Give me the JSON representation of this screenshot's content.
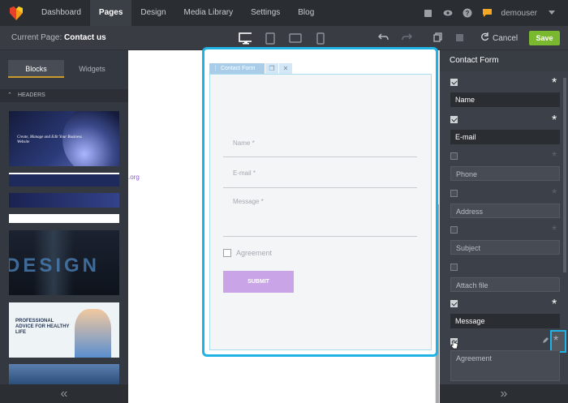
{
  "nav": {
    "items": [
      "Dashboard",
      "Pages",
      "Design",
      "Media Library",
      "Settings",
      "Blog"
    ],
    "active": "Pages",
    "user": "demouser"
  },
  "subbar": {
    "current_page_label": "Current Page:",
    "current_page_value": "Contact us",
    "cancel_label": "Cancel",
    "save_label": "Save"
  },
  "left": {
    "tabs": [
      "Blocks",
      "Widgets"
    ],
    "section": "HEADERS",
    "thumb_text": "Create, Manage and Edit Your Business Website",
    "thumb_design": "DESIGN",
    "thumb_advice": "PROFESSIONAL ADVICE FOR HEALTHY LIFE"
  },
  "canvas": {
    "side_text": ".org",
    "form_tab": "Contact Form",
    "fields": [
      "Name *",
      "E-mail *",
      "Message *"
    ],
    "agreement": "Agreement",
    "submit": "SUBMIT"
  },
  "right": {
    "title": "Contact Form",
    "rows": [
      {
        "label": "Name",
        "checked": true,
        "required": true
      },
      {
        "label": "E-mail",
        "checked": true,
        "required": true
      },
      {
        "label": "Phone",
        "checked": false,
        "required": false
      },
      {
        "label": "Address",
        "checked": false,
        "required": false
      },
      {
        "label": "Subject",
        "checked": false,
        "required": false
      },
      {
        "label": "Attach file",
        "checked": false,
        "required": false
      },
      {
        "label": "Message",
        "checked": true,
        "required": true
      }
    ],
    "agreement": "Agreement"
  },
  "colors": {
    "accent": "#1fb3e5",
    "save": "#7ab82f",
    "submit": "#c9a4e7",
    "tab_underline": "#c99a2e"
  }
}
